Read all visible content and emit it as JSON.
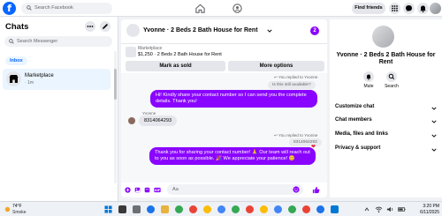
{
  "header": {
    "search_placeholder": "Search Facebook",
    "find_friends": "Find friends",
    "logo_letter": "f"
  },
  "sidebar": {
    "title": "Chats",
    "search_placeholder": "Search Messenger",
    "filter": "Inbox",
    "conversation": {
      "name": "Marketplace",
      "time": "· 1m"
    }
  },
  "chat": {
    "title": "Yvonne · 2 Beds 2 Bath House for Rent",
    "badge": "2",
    "marketplace_label": "Marketplace",
    "listing": "$1,250 · 2 Beds 2 Bath House for Rent",
    "mark_sold": "Mark as sold",
    "more_options": "More options",
    "replied_1": "You replied to Yvonne",
    "quoted_1": "Is this still available?",
    "msg_out_1": "Hi! Kindly share your contact number so I can send you the complete details. Thank you!",
    "sender_name": "Yvonne",
    "msg_in_1": "8314064293",
    "replied_2": "You replied to Yvonne",
    "quoted_2": "8314064293",
    "msg_out_2": "Thank you for sharing your contact number! 🙏 Our team will reach out to you as soon as possible. 🎉 We appreciate your patience! 😊",
    "compose_placeholder": "Aa"
  },
  "details": {
    "title": "Yvonne · 2 Beds 2 Bath House for Rent",
    "actions": [
      {
        "label": "Mute"
      },
      {
        "label": "Search"
      }
    ],
    "sections": [
      {
        "label": "Customize chat"
      },
      {
        "label": "Chat members"
      },
      {
        "label": "Media, files and links"
      },
      {
        "label": "Privacy & support"
      }
    ]
  },
  "taskbar": {
    "temp": "74°F",
    "weather": "Smoke",
    "time": "3:20 PM",
    "date": "6/11/2025"
  },
  "colors": {
    "accent": "#8a05ff",
    "brand": "#0866ff"
  }
}
